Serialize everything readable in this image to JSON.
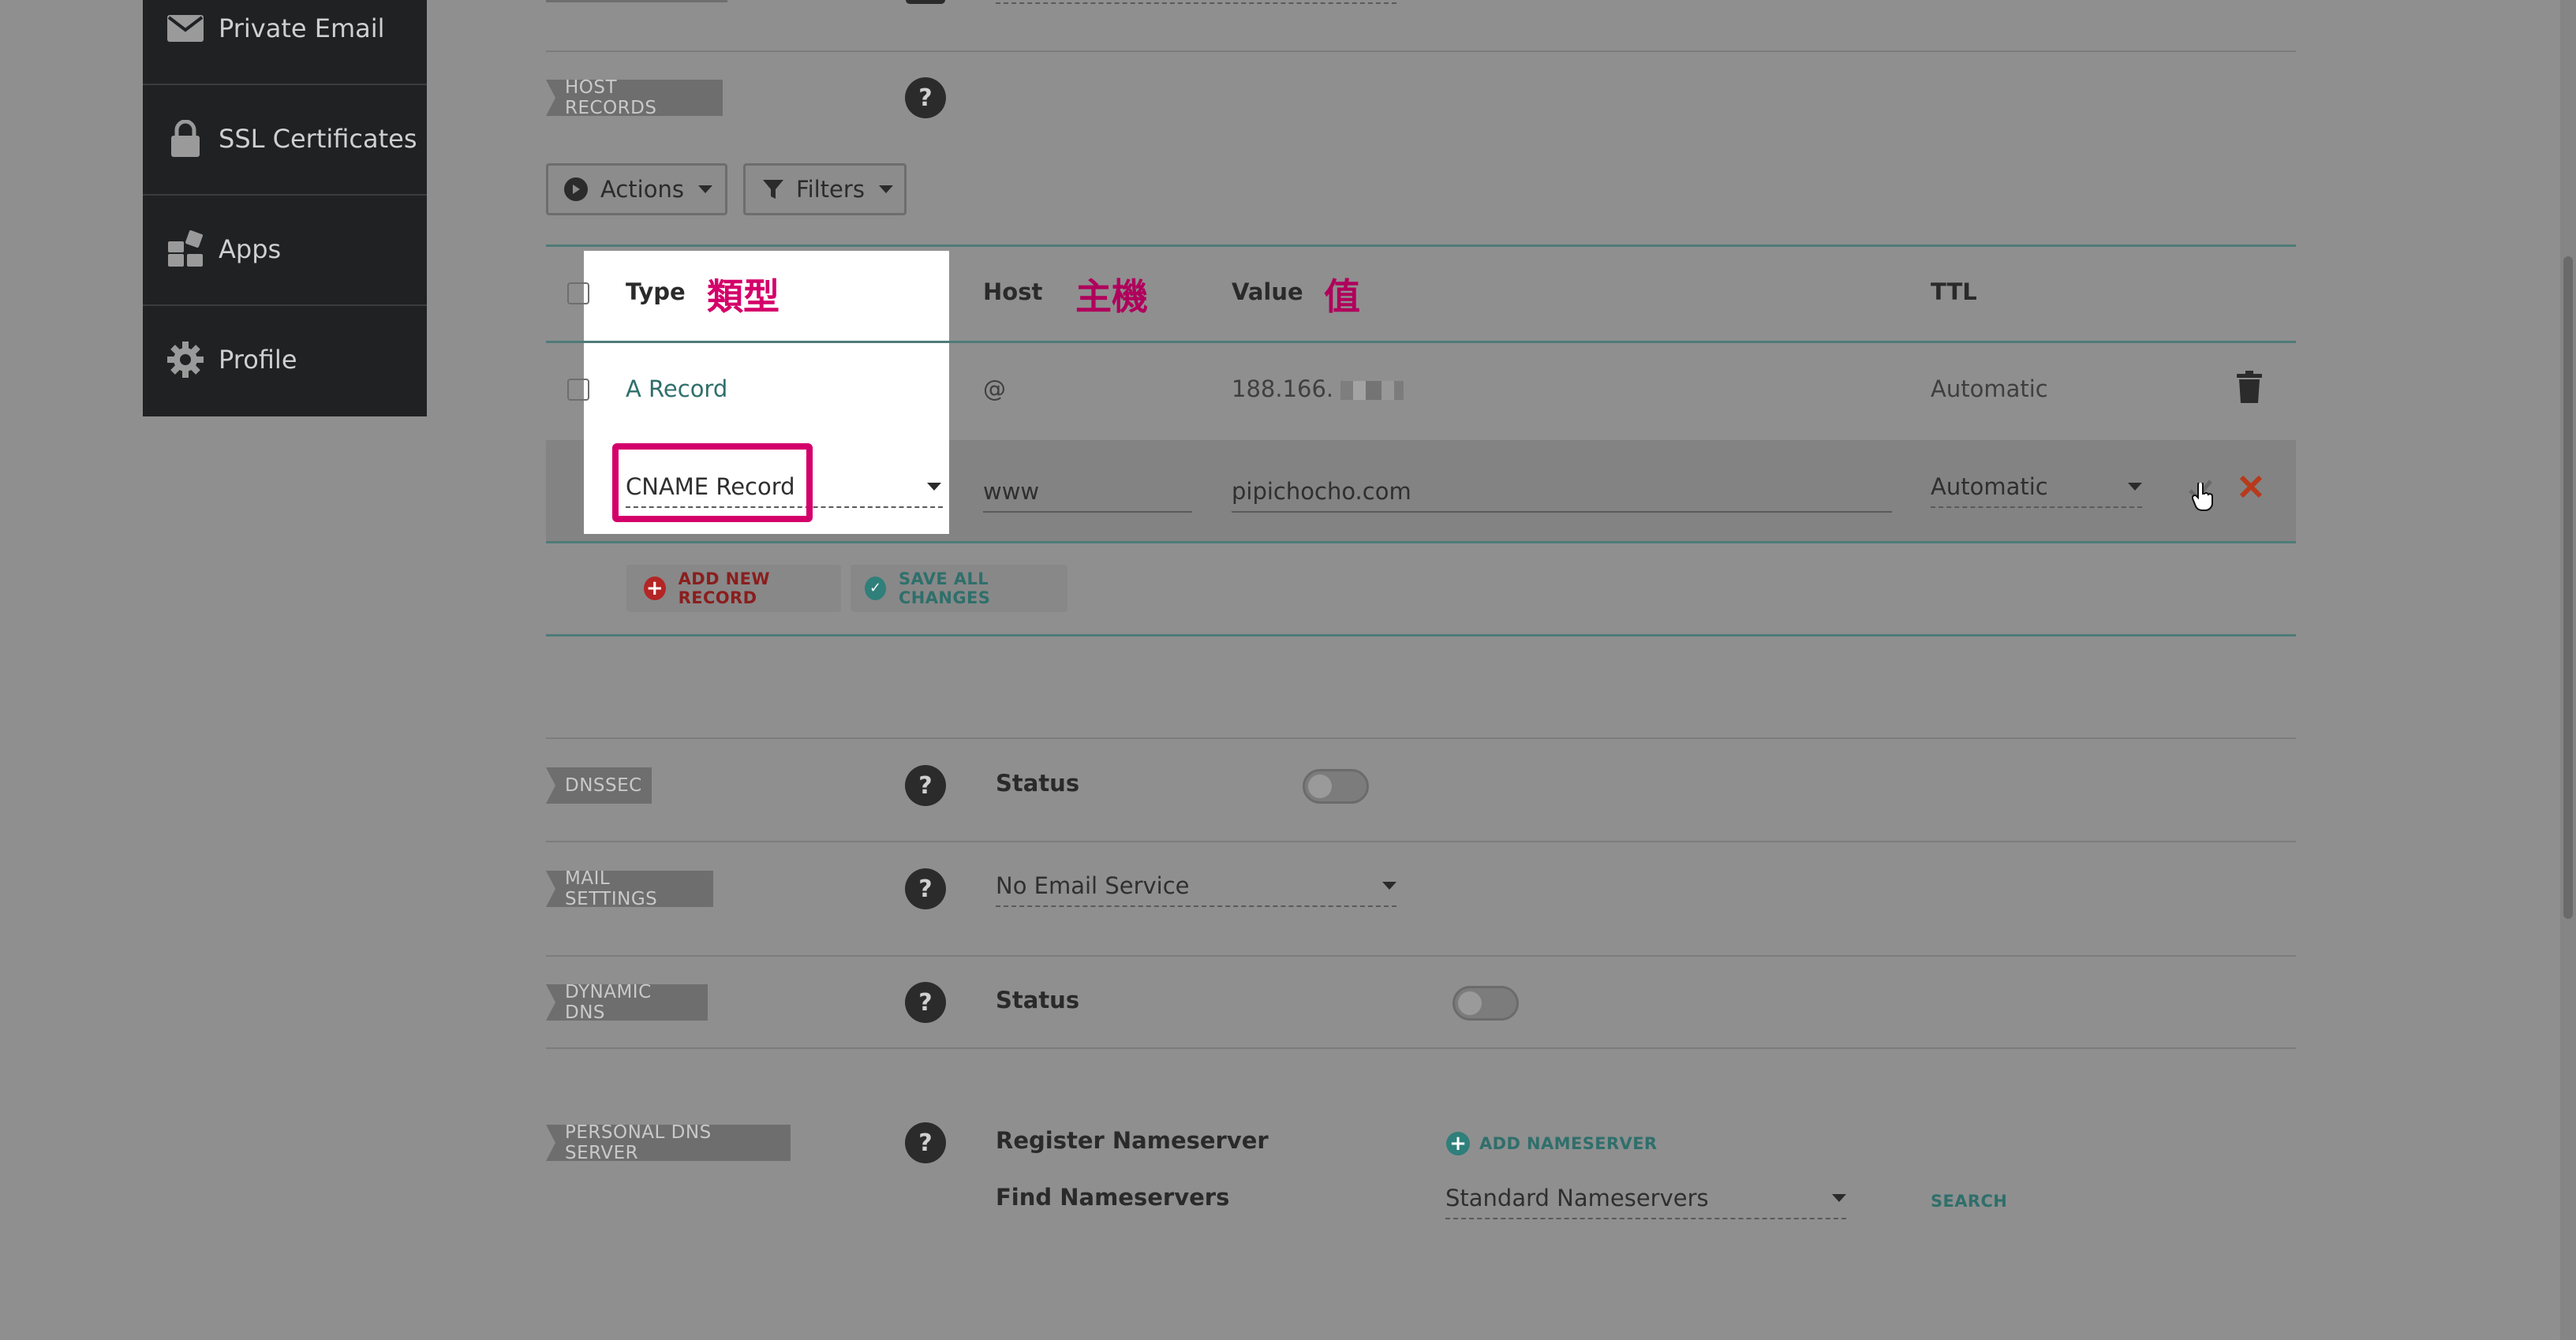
{
  "sidebar": {
    "items": [
      {
        "label": "Private Email",
        "icon": "envelope-icon"
      },
      {
        "label": "SSL Certificates",
        "icon": "lock-icon"
      },
      {
        "label": "Apps",
        "icon": "apps-grid-icon"
      },
      {
        "label": "Profile",
        "icon": "gear-icon"
      }
    ]
  },
  "host_records": {
    "tag": "HOST RECORDS",
    "help": "?",
    "actions_label": "Actions",
    "filters_label": "Filters",
    "columns": {
      "type": "Type",
      "host": "Host",
      "value": "Value",
      "ttl": "TTL"
    },
    "annotations": {
      "type": "類型",
      "host": "主機",
      "value": "值"
    },
    "rows": [
      {
        "type": "A Record",
        "host": "@",
        "value": "188.166.",
        "ttl": "Automatic"
      }
    ],
    "edit_row": {
      "type": "CNAME Record",
      "host": "www",
      "value": "pipichocho.com",
      "ttl": "Automatic"
    },
    "add_new_record": "ADD NEW RECORD",
    "save_all_changes": "SAVE ALL CHANGES"
  },
  "dnssec": {
    "tag": "DNSSEC",
    "help": "?",
    "status_label": "Status"
  },
  "mail_settings": {
    "tag": "MAIL SETTINGS",
    "help": "?",
    "value": "No Email Service"
  },
  "dynamic_dns": {
    "tag": "DYNAMIC DNS",
    "help": "?",
    "status_label": "Status"
  },
  "personal_dns": {
    "tag": "PERSONAL DNS SERVER",
    "help": "?",
    "register_label": "Register Nameserver",
    "add_nameserver": "ADD NAMESERVER",
    "find_label": "Find Nameservers",
    "find_value": "Standard Nameservers",
    "search_label": "SEARCH"
  },
  "colors": {
    "highlight": "#d4006a",
    "teal": "#4e7b78",
    "add_red": "#b42525",
    "save_teal": "#2f7f7a"
  }
}
